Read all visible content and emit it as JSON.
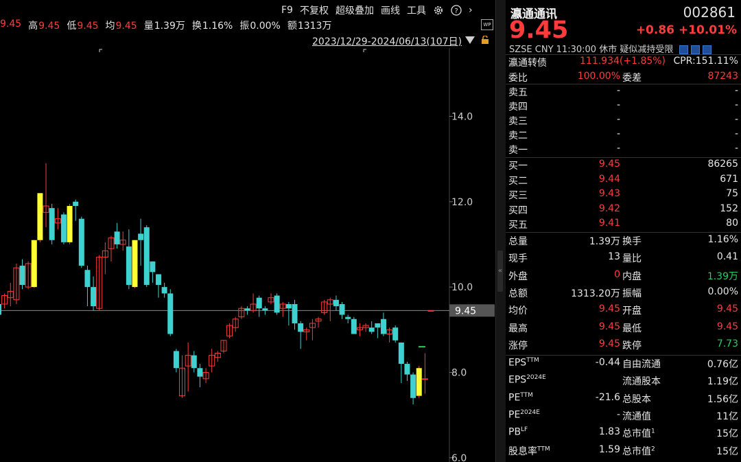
{
  "toolbar": {
    "f9": "F9",
    "no_adjust": "不复权",
    "overlay": "超级叠加",
    "draw": "画线",
    "tools": "工具",
    "gear_icon": "gear-icon",
    "help_icon": "help-icon",
    "more": "›"
  },
  "stats": {
    "prev_close_val": "9.45",
    "high_lbl": "高",
    "high_val": "9.45",
    "low_lbl": "低",
    "low_val": "9.45",
    "avg_lbl": "均",
    "avg_val": "9.45",
    "vol_lbl": "量",
    "vol_val": "1.39万",
    "turnover_lbl": "换",
    "turnover_val": "1.16%",
    "amp_lbl": "振",
    "amp_val": "0.00%",
    "amt_lbl": "额",
    "amt_val": "1313万"
  },
  "range_text": "2023/12/29-2024/06/13(107日)",
  "wp_label": "WP",
  "chart_data": {
    "type": "candlestick",
    "y_ticks": [
      "14.0",
      "12.0",
      "10.0",
      "8.0",
      "6.0"
    ],
    "ylim": [
      5.9,
      15.6
    ],
    "last_price_label": "9.45",
    "last_price": 9.45,
    "colors": {
      "up": "#ff3b3b",
      "down": "#3fd0d0",
      "limit_up": "#ffff33",
      "price_line": "#8a8a8a"
    },
    "candles": [
      [
        9.35,
        9.6,
        9.05,
        9.65,
        "down"
      ],
      [
        9.6,
        9.8,
        9.5,
        9.85,
        "up"
      ],
      [
        9.75,
        9.9,
        9.55,
        10.1,
        "up"
      ],
      [
        9.7,
        10.45,
        9.6,
        10.55,
        "up"
      ],
      [
        10.5,
        10.05,
        9.95,
        10.65,
        "down"
      ],
      [
        10.0,
        10.55,
        9.95,
        10.6,
        "up"
      ],
      [
        10.0,
        11.1,
        9.98,
        11.1,
        "limit_up"
      ],
      [
        11.1,
        12.2,
        11.05,
        12.2,
        "limit_up"
      ],
      [
        11.75,
        11.9,
        11.4,
        12.9,
        "up"
      ],
      [
        11.85,
        11.1,
        11.0,
        11.95,
        "down"
      ],
      [
        11.5,
        11.6,
        11.35,
        11.85,
        "up"
      ],
      [
        11.7,
        11.05,
        11.0,
        11.75,
        "down"
      ],
      [
        11.05,
        11.9,
        11.0,
        11.95,
        "limit_up"
      ],
      [
        11.9,
        12.0,
        11.55,
        12.05,
        "down"
      ],
      [
        11.6,
        10.5,
        10.45,
        11.65,
        "down"
      ],
      [
        10.4,
        10.0,
        9.55,
        10.5,
        "down"
      ],
      [
        10.0,
        9.55,
        9.45,
        10.25,
        "down"
      ],
      [
        9.5,
        10.7,
        9.45,
        10.75,
        "up"
      ],
      [
        10.7,
        10.85,
        10.3,
        11.05,
        "up"
      ],
      [
        10.9,
        11.15,
        10.6,
        11.2,
        "up"
      ],
      [
        11.3,
        11.0,
        10.9,
        11.5,
        "down"
      ],
      [
        11.0,
        11.1,
        10.85,
        11.3,
        "up"
      ],
      [
        10.95,
        10.05,
        9.95,
        11.35,
        "down"
      ],
      [
        10.0,
        11.1,
        9.97,
        11.1,
        "limit_up"
      ],
      [
        11.1,
        11.25,
        10.5,
        11.6,
        "down"
      ],
      [
        11.4,
        10.05,
        10.0,
        11.45,
        "down"
      ],
      [
        10.6,
        10.35,
        10.1,
        10.6,
        "down"
      ],
      [
        10.3,
        10.05,
        9.75,
        10.3,
        "down"
      ],
      [
        10.0,
        9.85,
        9.75,
        10.1,
        "down"
      ],
      [
        9.85,
        8.9,
        8.85,
        9.95,
        "down"
      ],
      [
        8.5,
        8.1,
        8.0,
        8.55,
        "down"
      ],
      [
        8.1,
        7.45,
        7.4,
        8.4,
        "up"
      ],
      [
        8.15,
        8.4,
        7.55,
        8.7,
        "up"
      ],
      [
        8.4,
        8.1,
        8.0,
        8.5,
        "down"
      ],
      [
        8.1,
        7.9,
        7.65,
        8.2,
        "down"
      ],
      [
        7.85,
        8.0,
        7.75,
        8.1,
        "up"
      ],
      [
        8.15,
        8.4,
        8.0,
        8.55,
        "up"
      ],
      [
        8.35,
        8.45,
        8.25,
        8.5,
        "up"
      ],
      [
        8.5,
        8.75,
        8.45,
        8.75,
        "up"
      ],
      [
        8.85,
        9.1,
        8.8,
        9.15,
        "up"
      ],
      [
        9.05,
        9.25,
        8.95,
        9.3,
        "up"
      ],
      [
        9.3,
        9.5,
        9.25,
        9.55,
        "up"
      ],
      [
        9.5,
        9.45,
        9.35,
        9.55,
        "down"
      ],
      [
        9.45,
        9.6,
        9.4,
        9.85,
        "up"
      ],
      [
        9.75,
        9.5,
        9.3,
        9.8,
        "down"
      ],
      [
        9.45,
        9.5,
        9.35,
        9.55,
        "down"
      ],
      [
        9.65,
        9.75,
        9.6,
        9.85,
        "up"
      ],
      [
        9.8,
        9.4,
        9.35,
        9.85,
        "down"
      ],
      [
        9.5,
        9.6,
        9.3,
        9.65,
        "up"
      ],
      [
        9.6,
        9.5,
        9.1,
        9.65,
        "down"
      ],
      [
        9.6,
        9.15,
        9.0,
        9.7,
        "down"
      ],
      [
        9.15,
        8.95,
        8.55,
        9.2,
        "down"
      ],
      [
        8.95,
        9.0,
        8.75,
        9.05,
        "up"
      ],
      [
        9.05,
        9.15,
        8.75,
        9.25,
        "up"
      ],
      [
        9.25,
        9.2,
        9.05,
        9.3,
        "up"
      ],
      [
        9.4,
        9.65,
        9.35,
        9.7,
        "up"
      ],
      [
        9.6,
        9.7,
        9.2,
        9.75,
        "up"
      ],
      [
        9.7,
        9.55,
        9.45,
        9.8,
        "down"
      ],
      [
        9.6,
        9.35,
        9.25,
        9.65,
        "down"
      ],
      [
        9.3,
        9.25,
        9.15,
        9.35,
        "down"
      ],
      [
        9.25,
        8.9,
        8.9,
        9.3,
        "down"
      ],
      [
        9.0,
        9.05,
        8.85,
        9.15,
        "up"
      ],
      [
        9.1,
        9.05,
        8.95,
        9.15,
        "up"
      ],
      [
        9.05,
        8.95,
        8.9,
        9.2,
        "down"
      ],
      [
        9.15,
        9.05,
        8.8,
        9.15,
        "down"
      ],
      [
        9.25,
        8.9,
        8.85,
        9.4,
        "down"
      ],
      [
        8.9,
        9.0,
        8.7,
        9.05,
        "up"
      ],
      [
        9.05,
        8.75,
        8.7,
        9.1,
        "down"
      ],
      [
        8.7,
        8.2,
        7.75,
        8.7,
        "down"
      ],
      [
        8.2,
        7.95,
        7.8,
        8.25,
        "down"
      ],
      [
        7.95,
        7.4,
        7.25,
        8.0,
        "down"
      ],
      [
        7.45,
        8.1,
        7.4,
        8.15,
        "limit_up"
      ],
      [
        7.85,
        7.85,
        7.5,
        8.45,
        "up"
      ],
      [
        9.45,
        9.45,
        9.45,
        9.45,
        "up"
      ]
    ]
  },
  "quote": {
    "name": "瀛通通讯",
    "code": "002861",
    "price": "9.45",
    "change": "+0.86",
    "change_pct": "+10.01%",
    "market": "SZSE",
    "currency": "CNY",
    "time": "11:30:00",
    "session": "休市",
    "notice": "疑似减持受限",
    "bond_name": "瀛通转债",
    "bond_price": "111.934(+1.85%)",
    "cpr": "CPR:151.11%",
    "wb_lbl": "委比",
    "wb_val": "100.00%",
    "wc_lbl": "委差",
    "wc_val": "87243",
    "asks": [
      {
        "label": "卖五",
        "price": "-",
        "vol": "-"
      },
      {
        "label": "卖四",
        "price": "-",
        "vol": "-"
      },
      {
        "label": "卖三",
        "price": "-",
        "vol": "-"
      },
      {
        "label": "卖二",
        "price": "-",
        "vol": "-"
      },
      {
        "label": "卖一",
        "price": "-",
        "vol": "-"
      }
    ],
    "bids": [
      {
        "label": "买一",
        "price": "9.45",
        "vol": "86265"
      },
      {
        "label": "买二",
        "price": "9.44",
        "vol": "671"
      },
      {
        "label": "买三",
        "price": "9.43",
        "vol": "75"
      },
      {
        "label": "买四",
        "price": "9.42",
        "vol": "152"
      },
      {
        "label": "买五",
        "price": "9.41",
        "vol": "80"
      }
    ],
    "stats": [
      {
        "l1": "总量",
        "v1": "1.39万",
        "c1": "white",
        "l2": "换手",
        "v2": "1.16%",
        "c2": "white"
      },
      {
        "l1": "现手",
        "v1": "13",
        "c1": "white",
        "l2": "量比",
        "v2": "0.41",
        "c2": "white"
      },
      {
        "l1": "外盘",
        "v1": "0",
        "c1": "red",
        "l2": "内盘",
        "v2": "1.39万",
        "c2": "green"
      },
      {
        "l1": "总额",
        "v1": "1313.20万",
        "c1": "white",
        "l2": "振幅",
        "v2": "0.00%",
        "c2": "white"
      },
      {
        "l1": "均价",
        "v1": "9.45",
        "c1": "red",
        "l2": "开盘",
        "v2": "9.45",
        "c2": "red"
      },
      {
        "l1": "最高",
        "v1": "9.45",
        "c1": "red",
        "l2": "最低",
        "v2": "9.45",
        "c2": "red"
      },
      {
        "l1": "涨停",
        "v1": "9.45",
        "c1": "red",
        "l2": "跌停",
        "v2": "7.73",
        "c2": "green"
      }
    ],
    "fundamentals": [
      {
        "l1": "EPS",
        "s1": "TTM",
        "v1": "-0.44",
        "l2": "自由流通",
        "s2": "",
        "v2": "0.76亿"
      },
      {
        "l1": "EPS",
        "s1": "2024E",
        "v1": "",
        "l2": "流通股本",
        "s2": "",
        "v2": "1.19亿"
      },
      {
        "l1": "PE",
        "s1": "TTM",
        "v1": "-21.6",
        "l2": "总股本",
        "s2": "",
        "v2": "1.56亿"
      },
      {
        "l1": "PE",
        "s1": "2024E",
        "v1": "-",
        "l2": "流通值",
        "s2": "",
        "v2": "11亿"
      },
      {
        "l1": "PB",
        "s1": "LF",
        "v1": "1.83",
        "l2": "总市值",
        "s2": "1",
        "v2": "15亿"
      },
      {
        "l1": "股息率",
        "s1": "TTM",
        "v1": "1.59",
        "l2": "总市值",
        "s2": "2",
        "v2": "15亿"
      }
    ]
  }
}
